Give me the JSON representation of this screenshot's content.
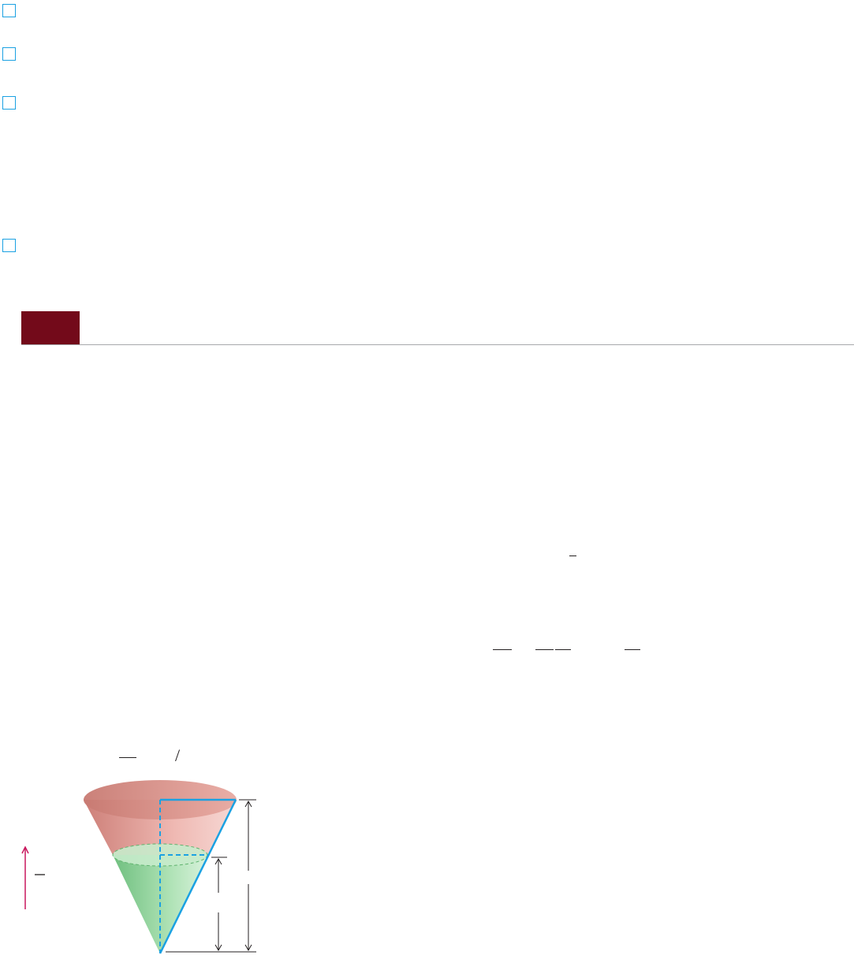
{
  "colors": {
    "checkbox_border": "#1ba1e2",
    "section_tab": "#730a1a",
    "section_rule": "#a7a9ac",
    "cone_top": "#d9908a",
    "water": "#8fd29a",
    "radius_line": "#1ba1e2",
    "rate_arrow": "#c8175d"
  },
  "icons": {
    "checkbox": "empty-checkbox-icon",
    "rate_arrow": "up-arrow-icon"
  },
  "figure": {
    "caption_slash": "/"
  }
}
